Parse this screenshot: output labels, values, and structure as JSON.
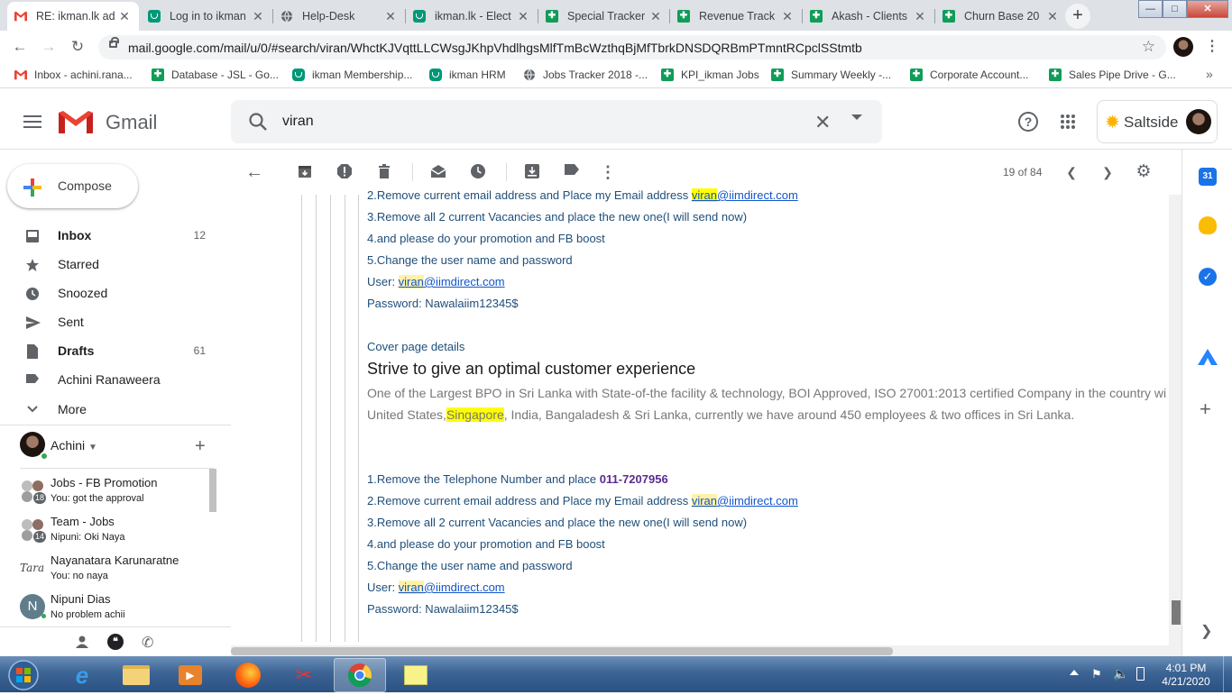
{
  "browser": {
    "tabs": [
      {
        "title": "RE: ikman.lk ad",
        "icon": "gmail-icon",
        "active": true
      },
      {
        "title": "Log in to ikman",
        "icon": "ikman-icon"
      },
      {
        "title": "Help-Desk",
        "icon": "globe-icon"
      },
      {
        "title": "ikman.lk - Elect",
        "icon": "ikman-icon"
      },
      {
        "title": "Special Tracker",
        "icon": "sheets-icon"
      },
      {
        "title": "Revenue Track",
        "icon": "sheets-icon"
      },
      {
        "title": "Akash - Clients",
        "icon": "sheets-icon"
      },
      {
        "title": "Churn Base 20",
        "icon": "sheets-icon"
      }
    ],
    "url": "mail.google.com/mail/u/0/#search/viran/WhctKJVqttLLCWsgJKhpVhdlhgsMlfTmBcWzthqBjMfTbrkDNSDQRBmPTmntRCpclSStmtb",
    "bookmarks": [
      {
        "label": "Inbox - achini.rana...",
        "icon": "gmail-icon"
      },
      {
        "label": "Database - JSL - Go...",
        "icon": "sheets-icon"
      },
      {
        "label": "ikman Membership...",
        "icon": "ikman-icon"
      },
      {
        "label": "ikman HRM",
        "icon": "ikman-icon"
      },
      {
        "label": "Jobs Tracker 2018 -...",
        "icon": "globe-icon"
      },
      {
        "label": "KPI_ikman Jobs",
        "icon": "sheets-icon"
      },
      {
        "label": "Summary Weekly -...",
        "icon": "sheets-icon"
      },
      {
        "label": "Corporate Account...",
        "icon": "sheets-icon"
      },
      {
        "label": "Sales Pipe Drive - G...",
        "icon": "sheets-icon"
      }
    ],
    "bookmarks_more": "»"
  },
  "gmail": {
    "product": "Gmail",
    "search_query": "viran",
    "account_brand": "Saltside",
    "compose_label": "Compose",
    "nav": [
      {
        "label": "Inbox",
        "count": "12",
        "bold": true,
        "icon": "inbox-icon"
      },
      {
        "label": "Starred",
        "count": "",
        "icon": "star-icon"
      },
      {
        "label": "Snoozed",
        "count": "",
        "icon": "clock-icon"
      },
      {
        "label": "Sent",
        "count": "",
        "icon": "send-icon"
      },
      {
        "label": "Drafts",
        "count": "61",
        "bold": true,
        "icon": "draft-icon"
      },
      {
        "label": "Achini Ranaweera",
        "count": "",
        "icon": "label-icon"
      },
      {
        "label": "More",
        "count": "",
        "icon": "chevron-down-icon"
      }
    ],
    "chat": {
      "user": "Achini",
      "rooms": [
        {
          "name": "Jobs - FB Promotion",
          "sub": "You: got the approval",
          "badge": "18"
        },
        {
          "name": "Team - Jobs",
          "sub": "Nipuni: Oki Naya",
          "badge": "14"
        },
        {
          "name": "Nayanatara Karunaratne",
          "sub": "You: no naya",
          "badge": ""
        },
        {
          "name": "Nipuni Dias",
          "sub": "No problem achii",
          "badge": ""
        }
      ],
      "avatar_letter": "N"
    },
    "pager": "19 of 84"
  },
  "message": {
    "top_steps": [
      {
        "pre": "2.Remove current email address and Place my Email address ",
        "hl": "viran",
        "post": "@iimdirect.com"
      },
      {
        "text": "3.Remove all 2 current Vacancies and place the new one(I will send now)"
      },
      {
        "text": "4.and please do your promotion and FB boost"
      },
      {
        "text": "5.Change the user name and password"
      }
    ],
    "user_label": "User: ",
    "user_hl": "viran",
    "user_domain": "@iimdirect.com",
    "password_line": "Password: Nawalaiim12345$",
    "cover_label": "Cover page details",
    "cover_heading": "Strive to give an optimal customer experience",
    "cover_line1": "One of the Largest BPO in Sri Lanka with State-of-the facility & technology, BOI Approved, ISO 27001:2013 certified Company in the country wi",
    "cover_line2_pre": "United States,",
    "cover_line2_hl": "Singapore",
    "cover_line2_post": ", India, Bangaladesh & Sri Lanka, currently we have around 450 employees & two offices in Sri Lanka.",
    "phone_line_pre": "1.Remove the Telephone Number and place ",
    "phone_number": "011-7207956",
    "step2_pre": "2.Remove current email address and Place my Email address ",
    "step2_hl": "viran",
    "step2_domain": "@iimdirect.com",
    "step3": "3.Remove all 2 current Vacancies and place the new one(I will send now)",
    "step4": "4.and please do your promotion and FB boost",
    "step5": "5.Change the user name and password"
  },
  "taskbar": {
    "time": "4:01 PM",
    "date": "4/21/2020"
  },
  "colors": {
    "gmail_red": "#ea4335",
    "link_blue": "#1155cc",
    "highlight": "#ffff00",
    "phone_purple": "#5b2c8f"
  }
}
